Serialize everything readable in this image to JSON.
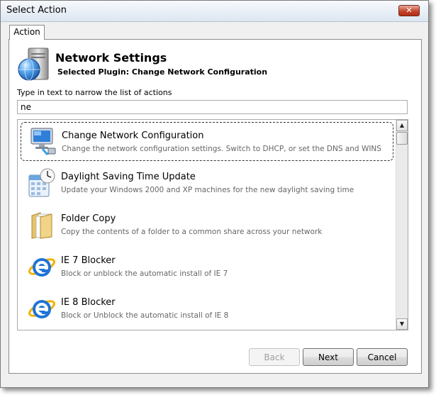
{
  "window": {
    "title": "Select Action",
    "close_label": "✕"
  },
  "tab": {
    "label": "Action"
  },
  "header": {
    "title": "Network Settings",
    "subtitle": "Selected Plugin: Change Network Configuration"
  },
  "filter": {
    "label": "Type in text to narrow the list of actions",
    "value": "ne"
  },
  "actions": [
    {
      "name": "Change Network Configuration",
      "description": "Change the network configuration settings. Switch to DHCP, or set the DNS and WINS",
      "icon": "network-computer-icon",
      "selected": true
    },
    {
      "name": "Daylight Saving Time Update",
      "description": "Update your Windows 2000 and XP machines for the new daylight saving time",
      "icon": "calendar-clock-icon",
      "selected": false
    },
    {
      "name": "Folder Copy",
      "description": "Copy the contents of a folder to a common share across your network",
      "icon": "folder-icon",
      "selected": false
    },
    {
      "name": "IE 7 Blocker",
      "description": "Block or unblock the automatic install of IE 7",
      "icon": "internet-explorer-icon",
      "selected": false
    },
    {
      "name": "IE 8 Blocker",
      "description": "Block or Unblock the automatic install of IE 8",
      "icon": "internet-explorer-icon",
      "selected": false
    }
  ],
  "buttons": {
    "back": "Back",
    "next": "Next",
    "cancel": "Cancel"
  }
}
